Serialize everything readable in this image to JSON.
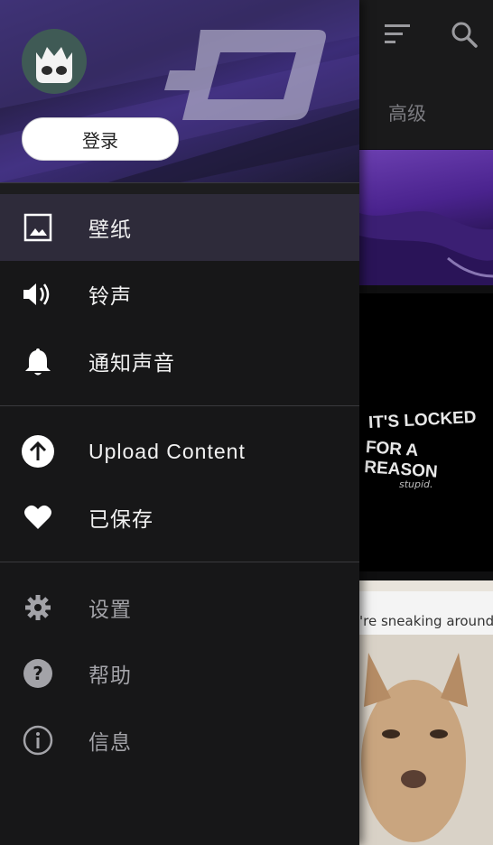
{
  "background_app": {
    "tab_label": "高级",
    "menu_icon": "sort-icon",
    "search_icon": "search-icon",
    "quote_text": "'re sneaking around\nstub your toe",
    "locked_text_line1": "IT'S LOCKED",
    "locked_text_line2": "FOR A REASON",
    "locked_text_line3": "stupid."
  },
  "drawer": {
    "login_label": "登录",
    "logo_icon": "zedge-logo",
    "avatar_icon": "monster-avatar-icon",
    "primary_items": [
      {
        "label": "壁纸",
        "icon": "image-icon",
        "active": true
      },
      {
        "label": "铃声",
        "icon": "speaker-icon",
        "active": false
      },
      {
        "label": "通知声音",
        "icon": "bell-icon",
        "active": false
      }
    ],
    "secondary_items": [
      {
        "label": "Upload Content",
        "icon": "upload-icon"
      },
      {
        "label": "已保存",
        "icon": "heart-icon"
      }
    ],
    "tertiary_items": [
      {
        "label": "设置",
        "icon": "gear-icon"
      },
      {
        "label": "帮助",
        "icon": "help-icon"
      },
      {
        "label": "信息",
        "icon": "info-icon"
      }
    ]
  },
  "colors": {
    "drawer_bg": "#171718",
    "active_row": "#2e2b3a",
    "header_purple": "#3a2e6e"
  }
}
